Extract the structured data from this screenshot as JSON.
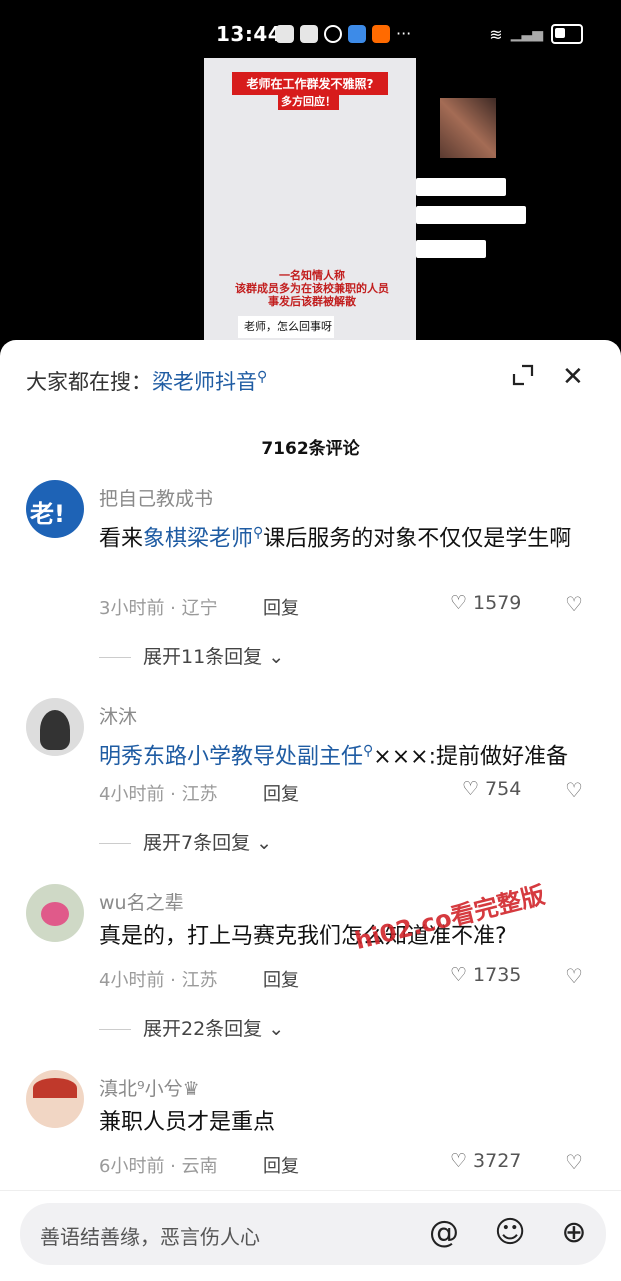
{
  "status": {
    "time": "13:44",
    "more": "···"
  },
  "video": {
    "title": "老师在工作群发不雅照?",
    "subtitle": "多方回应！",
    "overlay": "一名知情人称\n该群成员多为在该校兼职的人员\n事发后该群被解散",
    "question": "老师，怎么回事呀"
  },
  "search": {
    "prefix": "大家都在搜：",
    "keyword": "梁老师抖音"
  },
  "comments_count": "7162条评论",
  "comments": [
    {
      "user": "把自己教成书",
      "text_plain_1": "看来",
      "text_link": "象棋梁老师",
      "text_plain_2": "课后服务的对象不仅仅是学生啊",
      "time_loc": "3小时前 · 辽宁",
      "reply": "回复",
      "likes": "1579",
      "more": "展开11条回复"
    },
    {
      "user": "沐沐",
      "text_link": "明秀东路小学教导处副主任",
      "text_plain_2": "×××:提前做好准备",
      "time_loc": "4小时前 · 江苏",
      "reply": "回复",
      "likes": "754",
      "more": "展开7条回复"
    },
    {
      "user": "wu名之辈",
      "text_plain_1": "真是的，打上马赛克我们怎么知道准不准?",
      "time_loc": "4小时前 · 江苏",
      "reply": "回复",
      "likes": "1735",
      "more": "展开22条回复"
    },
    {
      "user": "滇北⁹小兮♛",
      "text_plain_1": "兼职人员才是重点",
      "time_loc": "6小时前 · 云南",
      "reply": "回复",
      "likes": "3727"
    }
  ],
  "watermark": "hi02.co看完整版",
  "input": {
    "placeholder": "善语结善缘，恶言伤人心"
  },
  "icons": [
    "at-icon",
    "emoji-icon",
    "plus-icon"
  ]
}
